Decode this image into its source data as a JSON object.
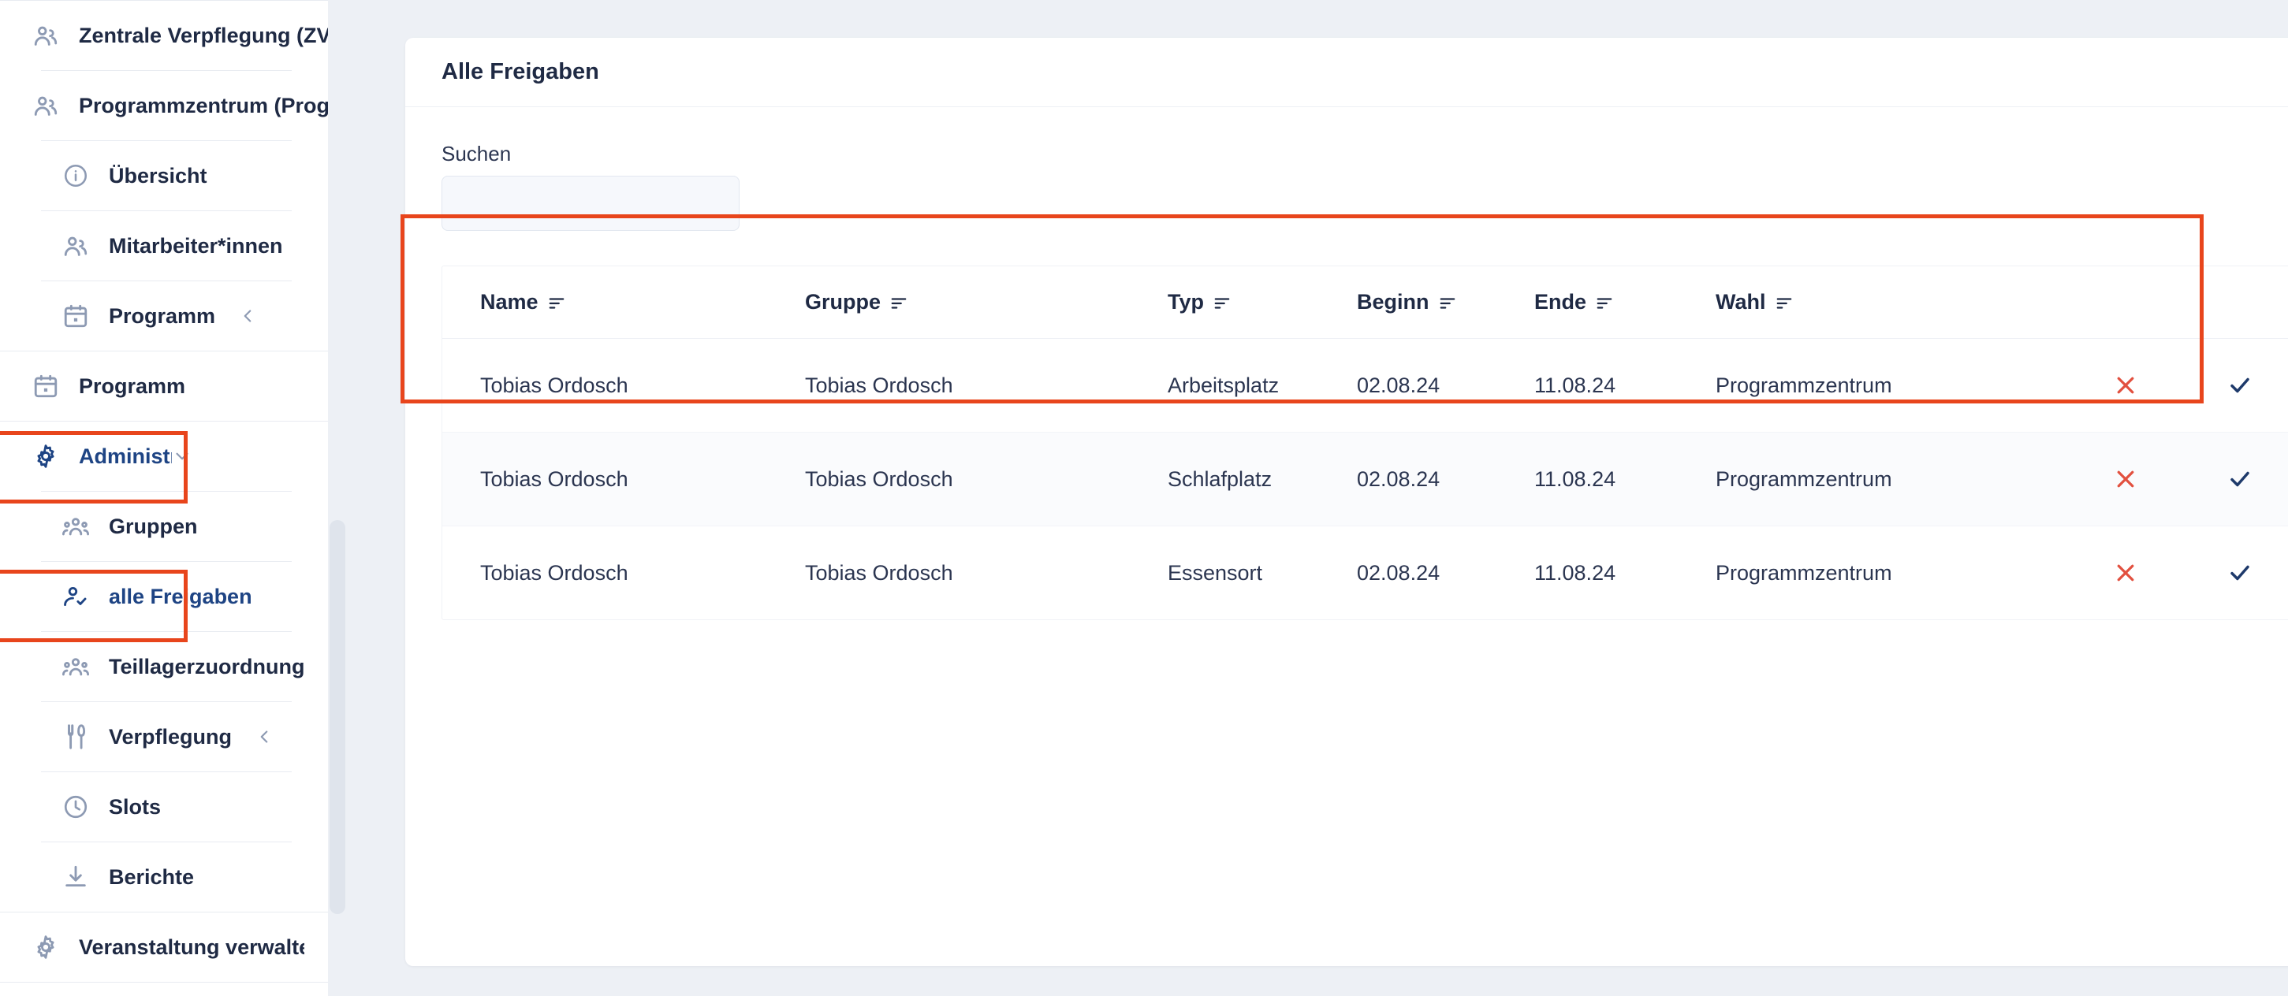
{
  "colors": {
    "annotation_red": "#e8451c",
    "active_blue": "#1e4484",
    "text_dark": "#1f2a44",
    "icon_gray": "#8d9ab3",
    "reject_red": "#e2503f",
    "accept_blue": "#1e3a6b",
    "page_bg": "#edf0f5"
  },
  "sidebar": {
    "items": [
      {
        "label": "Zentrale Verpflegung (ZVP)",
        "icon": "people-icon",
        "level": 1,
        "state": "default",
        "chevron": null
      },
      {
        "label": "Programmzentrum (Programm",
        "icon": "people-icon",
        "level": 1,
        "state": "default",
        "chevron": null
      },
      {
        "label": "Übersicht",
        "icon": "info-circle-icon",
        "level": 2,
        "state": "default",
        "chevron": null
      },
      {
        "label": "Mitarbeiter*innen",
        "icon": "people-icon",
        "level": 2,
        "state": "default",
        "chevron": null
      },
      {
        "label": "Programm",
        "icon": "calendar-icon",
        "level": 2,
        "state": "default",
        "chevron": "chevron-left-icon"
      },
      {
        "label": "Programm",
        "icon": "calendar-icon",
        "level": 1,
        "state": "default",
        "chevron": null
      },
      {
        "label": "Administration",
        "icon": "gear-icon",
        "level": 1,
        "state": "active",
        "chevron": "chevron-down-icon"
      },
      {
        "label": "Gruppen",
        "icon": "group-icon",
        "level": 2,
        "state": "default",
        "chevron": null
      },
      {
        "label": "alle Freigaben",
        "icon": "person-check-icon",
        "level": 2,
        "state": "selected",
        "chevron": null
      },
      {
        "label": "Teillagerzuordnung",
        "icon": "group-icon",
        "level": 2,
        "state": "default",
        "chevron": null
      },
      {
        "label": "Verpflegung",
        "icon": "cutlery-icon",
        "level": 2,
        "state": "default",
        "chevron": "chevron-left-icon"
      },
      {
        "label": "Slots",
        "icon": "clock-icon",
        "level": 2,
        "state": "default",
        "chevron": null
      },
      {
        "label": "Berichte",
        "icon": "download-icon",
        "level": 2,
        "state": "default",
        "chevron": null
      },
      {
        "label": "Veranstaltung verwalten",
        "icon": "gear-icon",
        "level": 1,
        "state": "default",
        "chevron": "chevron-left-icon"
      }
    ]
  },
  "main": {
    "card_title": "Alle Freigaben",
    "search": {
      "label": "Suchen",
      "value": "",
      "placeholder": ""
    },
    "table": {
      "columns": [
        {
          "label": "Name",
          "sort_icon": "sort-icon"
        },
        {
          "label": "Gruppe",
          "sort_icon": "sort-icon"
        },
        {
          "label": "Typ",
          "sort_icon": "sort-icon"
        },
        {
          "label": "Beginn",
          "sort_icon": "sort-icon"
        },
        {
          "label": "Ende",
          "sort_icon": "sort-icon"
        },
        {
          "label": "Wahl",
          "sort_icon": "sort-icon"
        },
        {
          "label": "",
          "sort_icon": null
        },
        {
          "label": "",
          "sort_icon": null
        }
      ],
      "rows": [
        {
          "name": "Tobias Ordosch",
          "gruppe": "Tobias Ordosch",
          "typ": "Arbeitsplatz",
          "beginn": "02.08.24",
          "ende": "11.08.24",
          "wahl": "Programmzentrum",
          "reject_icon": "close-x-icon",
          "accept_icon": "check-icon"
        },
        {
          "name": "Tobias Ordosch",
          "gruppe": "Tobias Ordosch",
          "typ": "Schlafplatz",
          "beginn": "02.08.24",
          "ende": "11.08.24",
          "wahl": "Programmzentrum",
          "reject_icon": "close-x-icon",
          "accept_icon": "check-icon"
        },
        {
          "name": "Tobias Ordosch",
          "gruppe": "Tobias Ordosch",
          "typ": "Essensort",
          "beginn": "02.08.24",
          "ende": "11.08.24",
          "wahl": "Programmzentrum",
          "reject_icon": "close-x-icon",
          "accept_icon": "check-icon"
        }
      ]
    }
  }
}
